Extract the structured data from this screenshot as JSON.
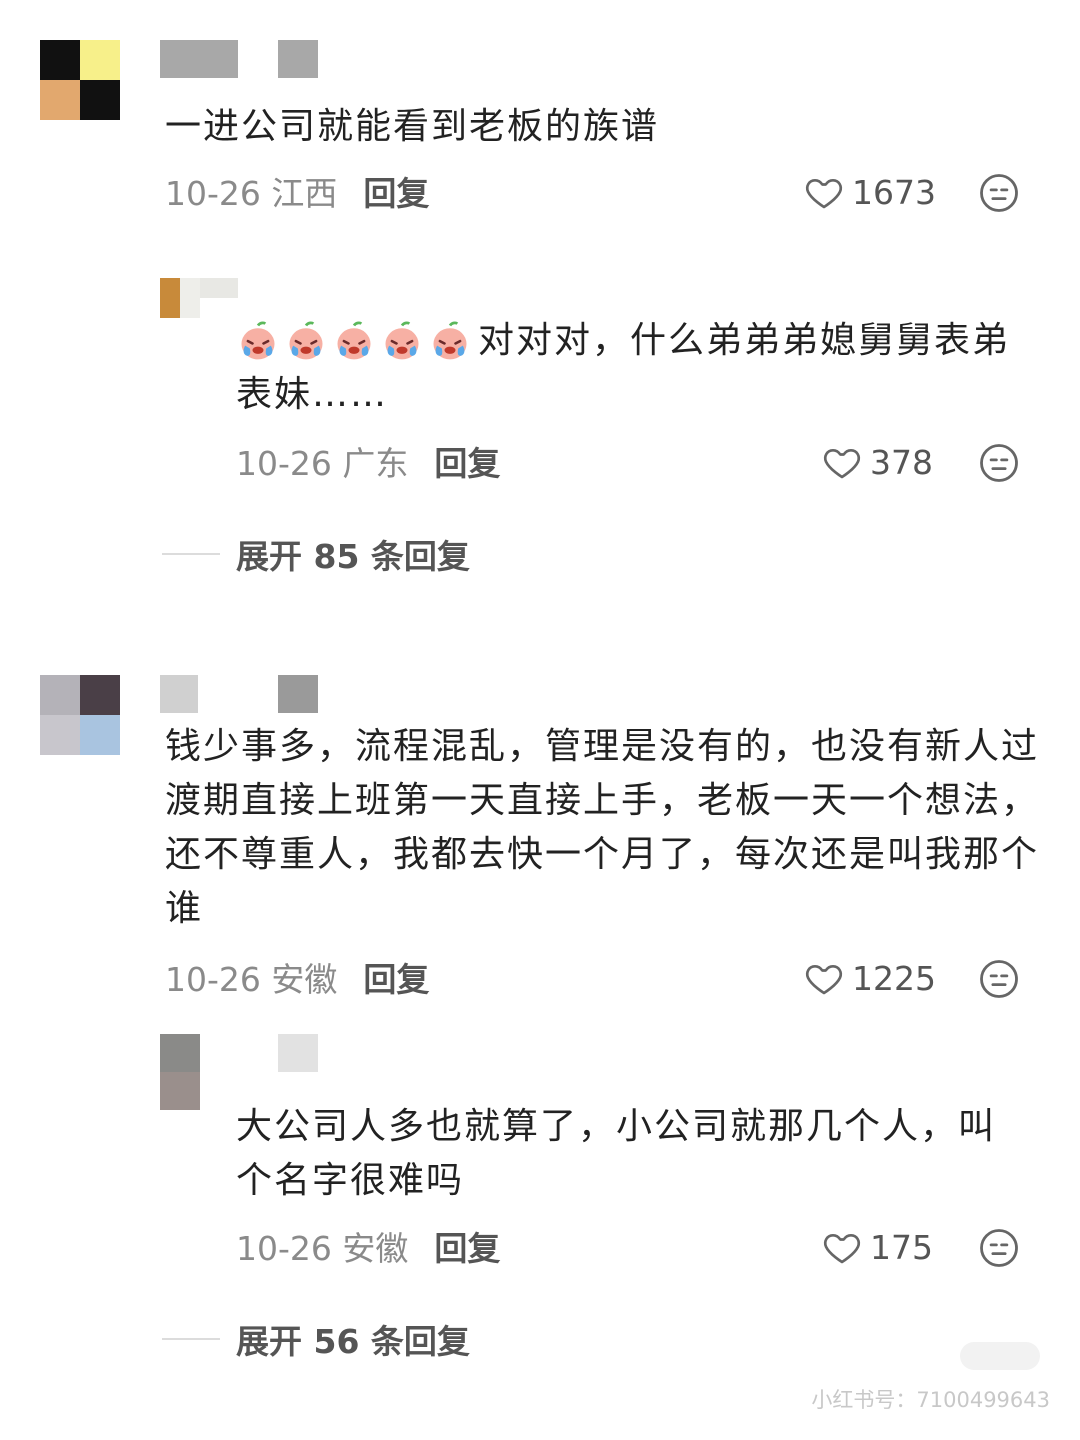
{
  "comments": [
    {
      "text": "一进公司就能看到老板的族谱",
      "date_location": "10-26 江西",
      "reply_label": "回复",
      "likes": "1673",
      "reply": {
        "text_emojis": [
          "crying-peach-emoji",
          "crying-peach-emoji",
          "crying-peach-emoji",
          "crying-peach-emoji",
          "crying-peach-emoji"
        ],
        "text": "对对对，什么弟弟弟媳舅舅表弟表妹……",
        "date_location": "10-26 广东",
        "reply_label": "回复",
        "likes": "378"
      },
      "expand_label": "展开 85 条回复"
    },
    {
      "text": "钱少事多，流程混乱，管理是没有的，也没有新人过渡期直接上班第一天直接上手，老板一天一个想法，还不尊重人，我都去快一个月了，每次还是叫我那个谁",
      "date_location": "10-26 安徽",
      "reply_label": "回复",
      "likes": "1225",
      "reply": {
        "text": "大公司人多也就算了，小公司就那几个人，叫个名字很难吗",
        "date_location": "10-26 安徽",
        "reply_label": "回复",
        "likes": "175"
      },
      "expand_label": "展开 56 条回复"
    }
  ],
  "watermark": "小红书号：7100499643",
  "icons": {
    "like": "heart-outline-icon",
    "react": "neutral-face-icon"
  },
  "colors": {
    "meta_gray": "#8a8a8a",
    "reply_gray": "#555555",
    "divider": "#dcdcdc"
  }
}
